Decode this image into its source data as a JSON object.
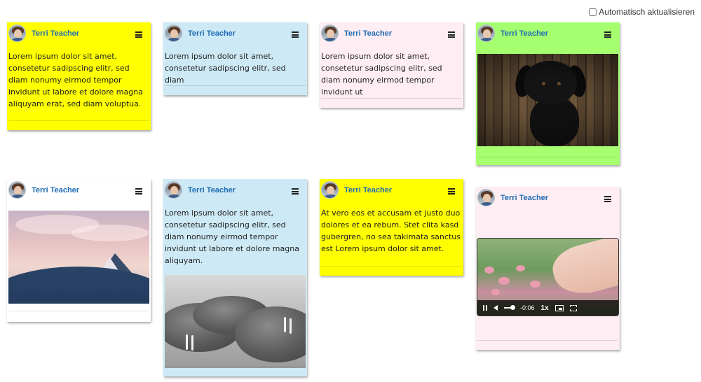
{
  "autoupdate": {
    "label": "Automatisch aktualisieren",
    "checked": false
  },
  "author": "Terri Teacher",
  "colors": {
    "yellow": "#ffff00",
    "blue": "#cde9f5",
    "pink": "#feeef3",
    "green": "#a5ff6e",
    "white": "#ffffff",
    "author": "#1f6bb5"
  },
  "cards": [
    {
      "color": "yellow",
      "text": "Lorem ipsum dolor sit amet, consetetur sadipscing elitr, sed diam nonumy eirmod tempor invidunt ut labore et dolore magna aliquyam erat, sed diam voluptua."
    },
    {
      "color": "blue",
      "text": "Lorem ipsum dolor sit amet, consetetur sadipscing elitr, sed diam"
    },
    {
      "color": "pink",
      "text": "Lorem ipsum dolor sit amet, consetetur sadipscing elitr, sed diam nonumy eirmod tempor invidunt ut"
    },
    {
      "color": "green",
      "media": "image-dog"
    },
    {
      "color": "white",
      "media": "image-mountain"
    },
    {
      "color": "blue",
      "text": "Lorem ipsum dolor sit amet, consetetur sadipscing elitr, sed diam nonumy eirmod tempor invidunt ut labore et dolore magna aliquyam.",
      "media": "image-walrus"
    },
    {
      "color": "yellow",
      "text": "At vero eos et accusam et justo duo dolores et ea rebum. Stet clita kasd gubergren, no sea takimata sanctus est Lorem ipsum dolor sit amet."
    },
    {
      "color": "pink",
      "media": "video"
    }
  ],
  "video": {
    "time": "-0:06",
    "speed": "1x"
  }
}
